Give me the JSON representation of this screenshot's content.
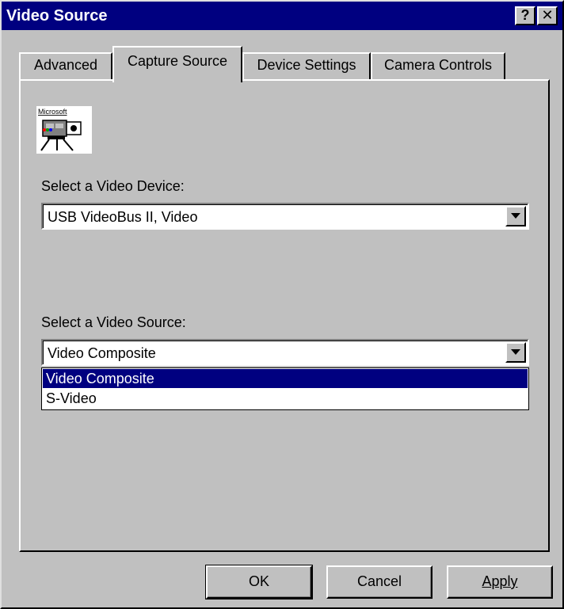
{
  "window": {
    "title": "Video Source",
    "help_label": "?",
    "close_label": "✕"
  },
  "tabs": [
    {
      "label": "Advanced",
      "active": false
    },
    {
      "label": "Capture Source",
      "active": true
    },
    {
      "label": "Device Settings",
      "active": false
    },
    {
      "label": "Camera Controls",
      "active": false
    }
  ],
  "logo": {
    "text": "Microsoft",
    "icon": "video-camera-icon"
  },
  "device": {
    "label": "Select a Video Device:",
    "value": "USB VideoBus II, Video"
  },
  "source": {
    "label": "Select a Video Source:",
    "value": "Video Composite",
    "options": [
      "Video Composite",
      "S-Video"
    ],
    "selected_index": 0
  },
  "buttons": {
    "ok": "OK",
    "cancel": "Cancel",
    "apply": "Apply"
  },
  "colors": {
    "titlebar": "#000080",
    "face": "#c0c0c0",
    "selection": "#000080"
  }
}
